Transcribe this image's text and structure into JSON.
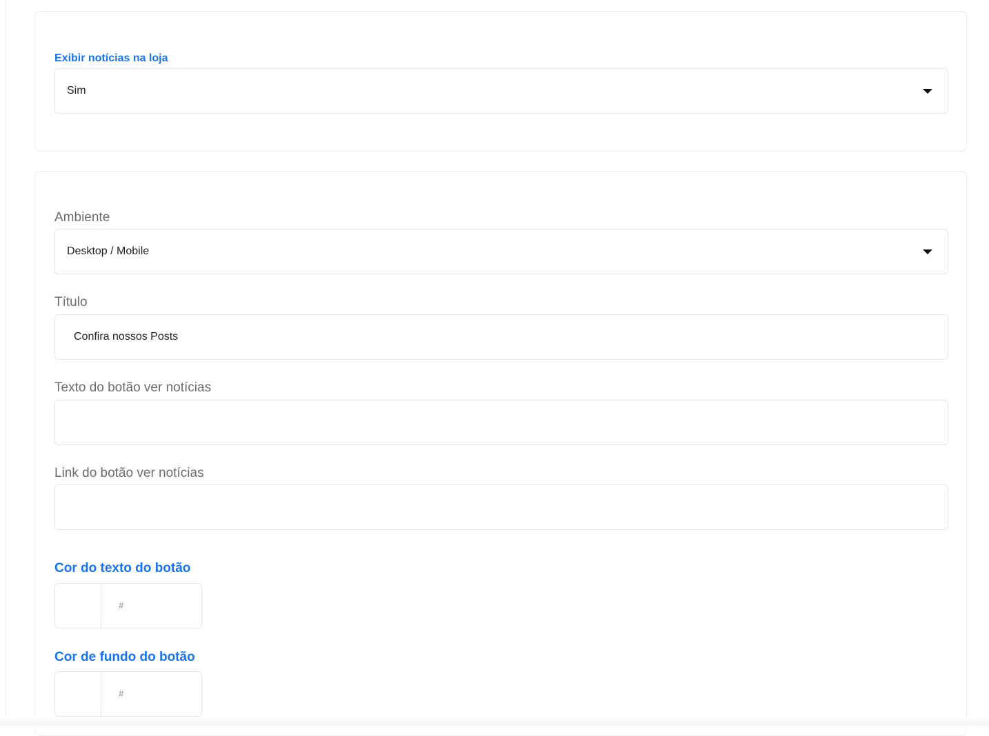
{
  "news_section": {
    "show_news_label": "Exibir notícias na loja",
    "show_news_value": "Sim"
  },
  "settings_section": {
    "environment_label": "Ambiente",
    "environment_value": "Desktop / Mobile",
    "title_label": "Título",
    "title_value": "Confira nossos Posts",
    "button_text_label": "Texto do botão ver notícias",
    "button_text_value": "",
    "button_link_label": "Link do botão ver notícias",
    "button_link_value": "",
    "text_color_label": "Cor do texto do botão",
    "text_color_prefix": "#",
    "bg_color_label": "Cor de fundo do botão",
    "bg_color_prefix": "#"
  },
  "colors": {
    "accent": "#1a73e8",
    "label_gray": "#6b6b6b",
    "border": "#e6e6e6"
  },
  "icons": {
    "dropdown": "caret-down-icon"
  }
}
